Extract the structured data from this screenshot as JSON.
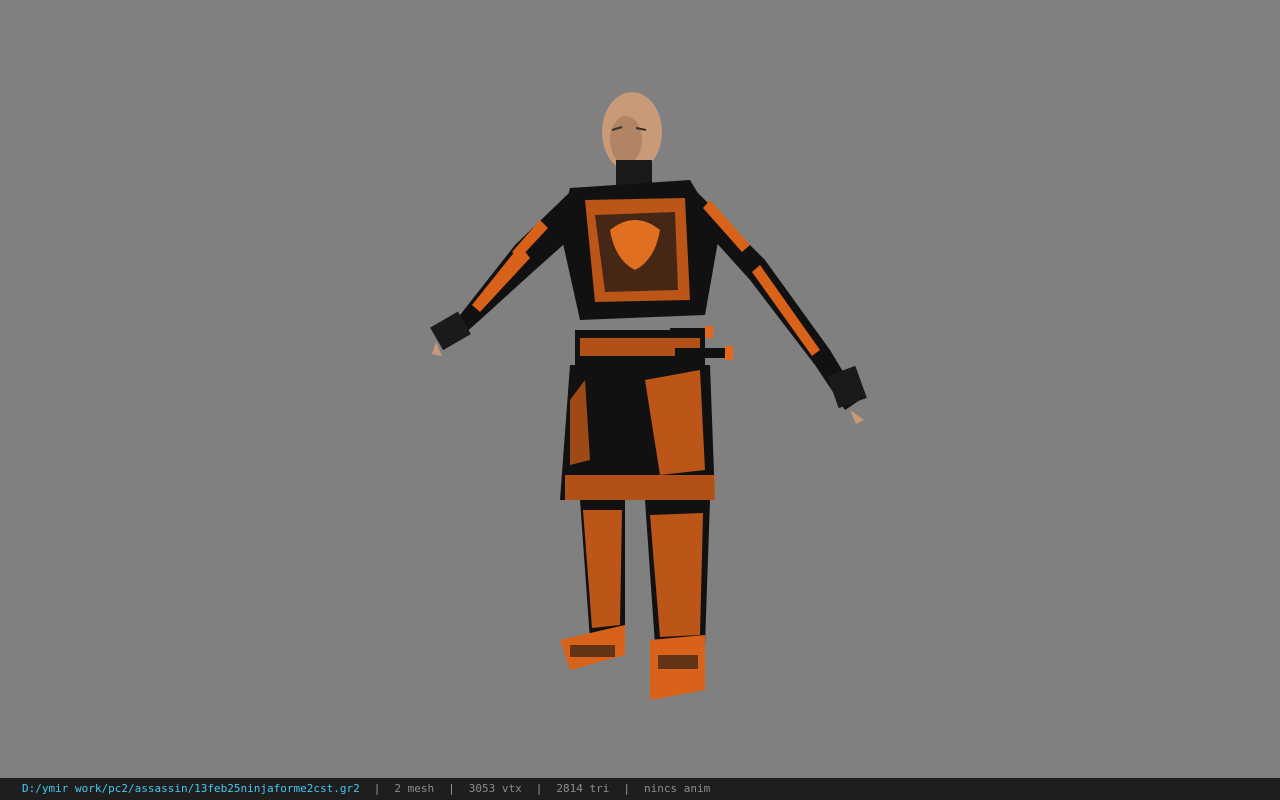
{
  "viewer": {
    "background_color": "#808080",
    "model_icon": "character-model-icon"
  },
  "status": {
    "file_path": "D:/ymir work/pc2/assassin/13feb25ninjaforme2cst.gr2",
    "separator": "|",
    "mesh": "2 mesh",
    "vtx": "3053 vtx",
    "tri": "2814 tri",
    "anim": "nincs anim",
    "path_color": "#46c8f0"
  }
}
